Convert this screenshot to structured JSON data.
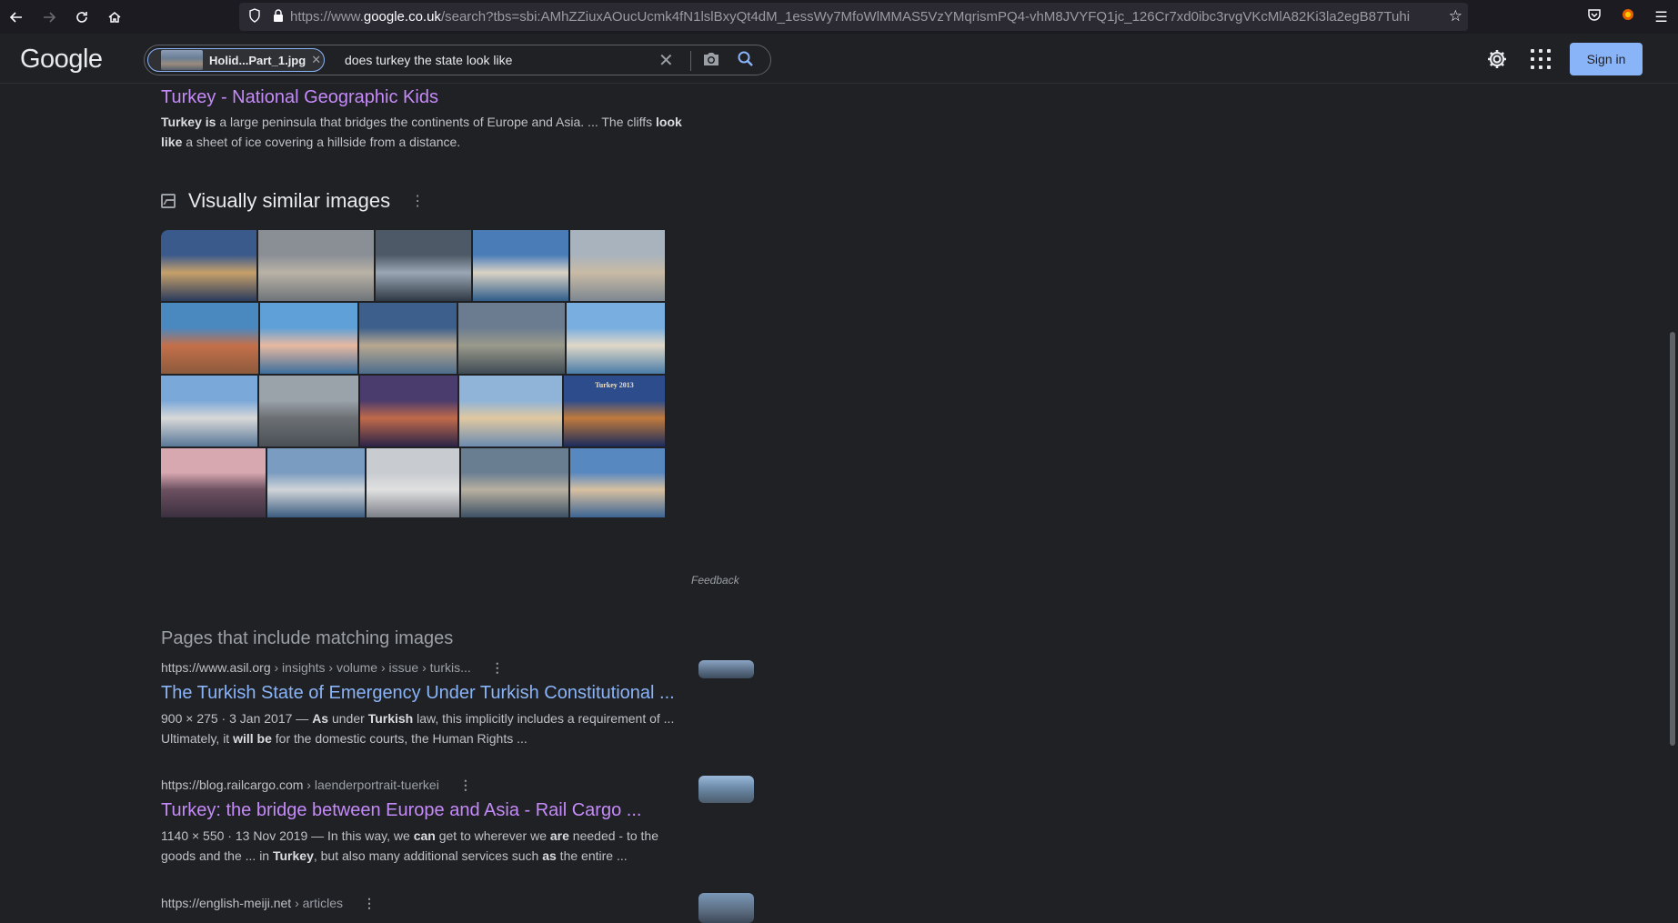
{
  "browser": {
    "url_prefix": "https://www.",
    "url_host": "google.co.uk",
    "url_rest": "/search?tbs=sbi:AMhZZiuxAOucUcmk4fN1lslBxyQt4dM_1essWy7MfoWlMMAS5VzYMqrismPQ4-vhM8JVYFQ1jc_126Cr7xd0ibc3rvgVKcMlA82Ki3la2egB87Tuhi"
  },
  "header": {
    "logo": "Google",
    "image_chip_label": "Holid...Part_1.jpg",
    "search_query": "does turkey the state look like",
    "signin_label": "Sign in"
  },
  "top_result": {
    "title": "Turkey - National Geographic Kids",
    "snippet_html_parts": [
      {
        "b": "Turkey is"
      },
      {
        "t": " a large peninsula that bridges the continents of Europe and Asia. ... The cliffs "
      },
      {
        "b": "look like"
      },
      {
        "t": " a sheet of ice covering a hillside from a distance."
      }
    ]
  },
  "visually_similar": {
    "title": "Visually similar images",
    "feedback_label": "Feedback",
    "tile_overlay_text": "Turkey 2013",
    "tile_colors": [
      [
        "#3b5a8c",
        "#c7a06a",
        "#2a3b5c"
      ],
      [
        "#8a8f96",
        "#b9b2a6",
        "#6f7479"
      ],
      [
        "#4d5966",
        "#9aa6b3",
        "#2e3945"
      ],
      [
        "#4a7db8",
        "#d9d2c4",
        "#2f5d8a"
      ],
      [
        "#a9b3bd",
        "#c9bba5",
        "#7d8791"
      ],
      [
        "#4a88c0",
        "#c4704a",
        "#8c5a3c"
      ],
      [
        "#5fa0d8",
        "#e8b9a0",
        "#3c6e9c"
      ],
      [
        "#3c5f8c",
        "#b8a890",
        "#4c6c8c"
      ],
      [
        "#6c7c90",
        "#9a9a8c",
        "#3e4a54"
      ],
      [
        "#78aee0",
        "#e0d8c8",
        "#4a7ca8"
      ],
      [
        "#7aa8d8",
        "#d8d8d8",
        "#5a7898"
      ],
      [
        "#9aa2aa",
        "#6c7074",
        "#4a5056"
      ],
      [
        "#4a3c6c",
        "#c06a4a",
        "#2c2448"
      ],
      [
        "#8fb4d8",
        "#e0c8a0",
        "#6c8cb0"
      ],
      [
        "#2c4c8c",
        "#c07a3c",
        "#1c2c5c"
      ],
      [
        "#d8a8b0",
        "#6c5060",
        "#3c3040"
      ],
      [
        "#7a9cc0",
        "#d0d4d8",
        "#3c5c80"
      ],
      [
        "#c8ccd0",
        "#e0e0e0",
        "#7c8088"
      ],
      [
        "#6a7e92",
        "#b8b0a0",
        "#3c5064"
      ],
      [
        "#5888c0",
        "#d8c0a0",
        "#3c6494"
      ]
    ]
  },
  "matching_pages": {
    "section_title": "Pages that include matching images",
    "results": [
      {
        "cite_host": "https://www.asil.org",
        "cite_path": " › insights › volume › issue › turkis...",
        "title": "The Turkish State of Emergency Under Turkish Constitutional ...",
        "line1_parts": [
          {
            "t": "900 × 275 · 3 Jan 2017 — "
          },
          {
            "b": "As"
          },
          {
            "t": " under "
          },
          {
            "b": "Turkish"
          },
          {
            "t": " law, this implicitly includes a requirement of ..."
          }
        ],
        "line2_parts": [
          {
            "t": "Ultimately, it "
          },
          {
            "b": "will be"
          },
          {
            "t": " for the domestic courts, the Human Rights ..."
          }
        ]
      },
      {
        "cite_host": "https://blog.railcargo.com",
        "cite_path": " › laenderportrait-tuerkei",
        "title": "Turkey: the bridge between Europe and Asia - Rail Cargo ...",
        "line1_parts": [
          {
            "t": "1140 × 550 · 13 Nov 2019 — In this way, we "
          },
          {
            "b": "can"
          },
          {
            "t": " get to wherever we "
          },
          {
            "b": "are"
          },
          {
            "t": " needed - to the"
          }
        ],
        "line2_parts": [
          {
            "t": "goods and the ... in "
          },
          {
            "b": "Turkey"
          },
          {
            "t": ", but also many additional services such "
          },
          {
            "b": "as"
          },
          {
            "t": " the entire ..."
          }
        ]
      },
      {
        "cite_host": "https://english-meiji.net",
        "cite_path": " › articles",
        "title": "",
        "line1_parts": [],
        "line2_parts": []
      }
    ]
  }
}
